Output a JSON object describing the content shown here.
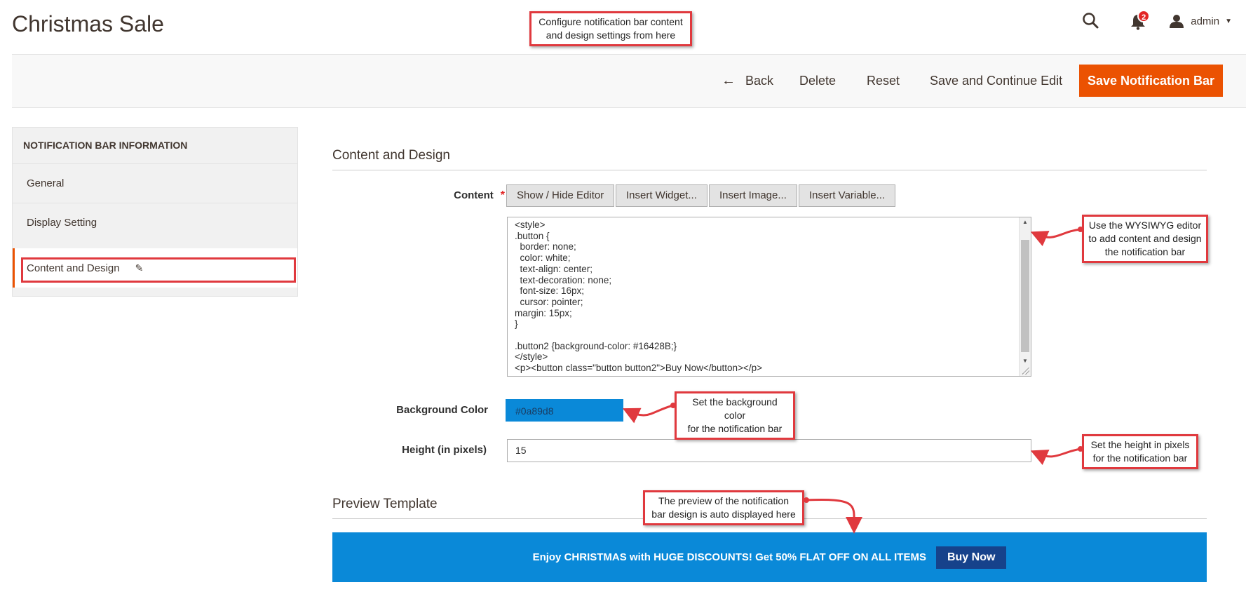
{
  "page": {
    "title": "Christmas Sale"
  },
  "header": {
    "notification_count": "2",
    "user_name": "admin"
  },
  "toolbar": {
    "back_label": "Back",
    "delete_label": "Delete",
    "reset_label": "Reset",
    "save_continue_label": "Save and Continue Edit",
    "save_label": "Save Notification Bar"
  },
  "sidebar": {
    "heading": "NOTIFICATION BAR INFORMATION",
    "items": [
      {
        "label": "General"
      },
      {
        "label": "Display Setting"
      },
      {
        "label": "Content and Design",
        "active": true
      }
    ]
  },
  "content_section": {
    "title": "Content and Design",
    "content_label": "Content",
    "required_mark": "*",
    "editor_buttons": [
      "Show / Hide Editor",
      "Insert Widget...",
      "Insert Image...",
      "Insert Variable..."
    ],
    "editor_value": "<style>\n.button {\n  border: none;\n  color: white;\n  text-align: center;\n  text-decoration: none;\n  font-size: 16px;\n  cursor: pointer;\nmargin: 15px;\n}\n\n.button2 {background-color: #16428B;}\n</style>\n<p><button class=\"button button2\">Buy Now</button></p>",
    "bg_color_label": "Background Color",
    "bg_color_value": "#0a89d8",
    "height_label": "Height (in pixels)",
    "height_value": "15"
  },
  "preview_section": {
    "title": "Preview Template",
    "bar_text": "Enjoy CHRISTMAS with HUGE DISCOUNTS! Get 50% FLAT OFF ON ALL ITEMS",
    "bar_button": "Buy Now"
  },
  "annotations": {
    "top": "Configure notification bar content\nand design settings from here",
    "editor": "Use the WYSIWYG editor\nto add content and design\nthe notification bar",
    "bg_color": "Set the background color\nfor the notification bar",
    "height": "Set the height in pixels\nfor the notification bar",
    "preview": "The preview of the notification\nbar design is auto displayed here"
  },
  "colors": {
    "accent": "#eb5202",
    "annotation_border": "#e0393e",
    "preview_background": "#0a89d8",
    "preview_button": "#16428b"
  }
}
